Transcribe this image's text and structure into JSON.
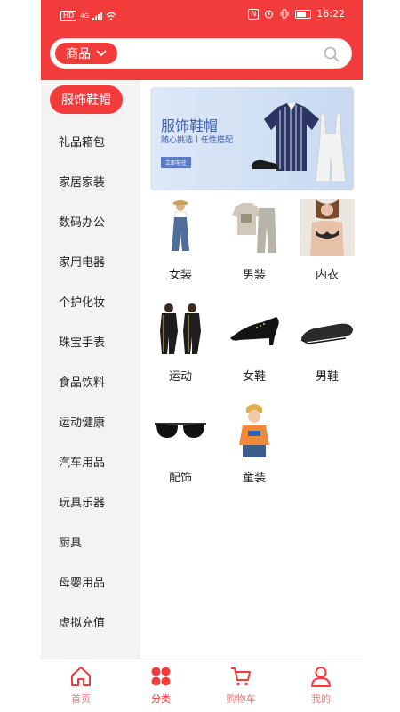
{
  "status_bar": {
    "hd_label": "HD",
    "network_label": "4G",
    "nfc_label": "N",
    "time": "16:22"
  },
  "search": {
    "category": "商品"
  },
  "sidebar": {
    "items": [
      {
        "label": "服饰鞋帽",
        "active": true
      },
      {
        "label": "礼品箱包"
      },
      {
        "label": "家居家装"
      },
      {
        "label": "数码办公"
      },
      {
        "label": "家用电器"
      },
      {
        "label": "个护化妆"
      },
      {
        "label": "珠宝手表"
      },
      {
        "label": "食品饮料"
      },
      {
        "label": "运动健康"
      },
      {
        "label": "汽车用品"
      },
      {
        "label": "玩具乐器"
      },
      {
        "label": "厨具"
      },
      {
        "label": "母婴用品"
      },
      {
        "label": "虚拟充值"
      }
    ]
  },
  "banner": {
    "title": "服饰鞋帽",
    "subtitle": "随心挑选丨任性搭配",
    "button": "立即前往"
  },
  "grid": {
    "items": [
      {
        "label": "女装",
        "icon": "women-clothing-icon"
      },
      {
        "label": "男装",
        "icon": "men-clothing-icon"
      },
      {
        "label": "内衣",
        "icon": "underwear-icon"
      },
      {
        "label": "运动",
        "icon": "sportswear-icon"
      },
      {
        "label": "女鞋",
        "icon": "women-shoes-icon"
      },
      {
        "label": "男鞋",
        "icon": "men-shoes-icon"
      },
      {
        "label": "配饰",
        "icon": "sunglasses-icon"
      },
      {
        "label": "童装",
        "icon": "kids-clothing-icon"
      }
    ]
  },
  "tabbar": {
    "items": [
      {
        "label": "首页",
        "icon": "home-icon"
      },
      {
        "label": "分类",
        "icon": "category-icon",
        "active": true
      },
      {
        "label": "购物车",
        "icon": "cart-icon"
      },
      {
        "label": "我的",
        "icon": "user-icon"
      }
    ]
  },
  "colors": {
    "accent": "#f23b3b",
    "tab_inactive": "#f27b7b",
    "sidebar_bg": "#f3f3f3"
  }
}
